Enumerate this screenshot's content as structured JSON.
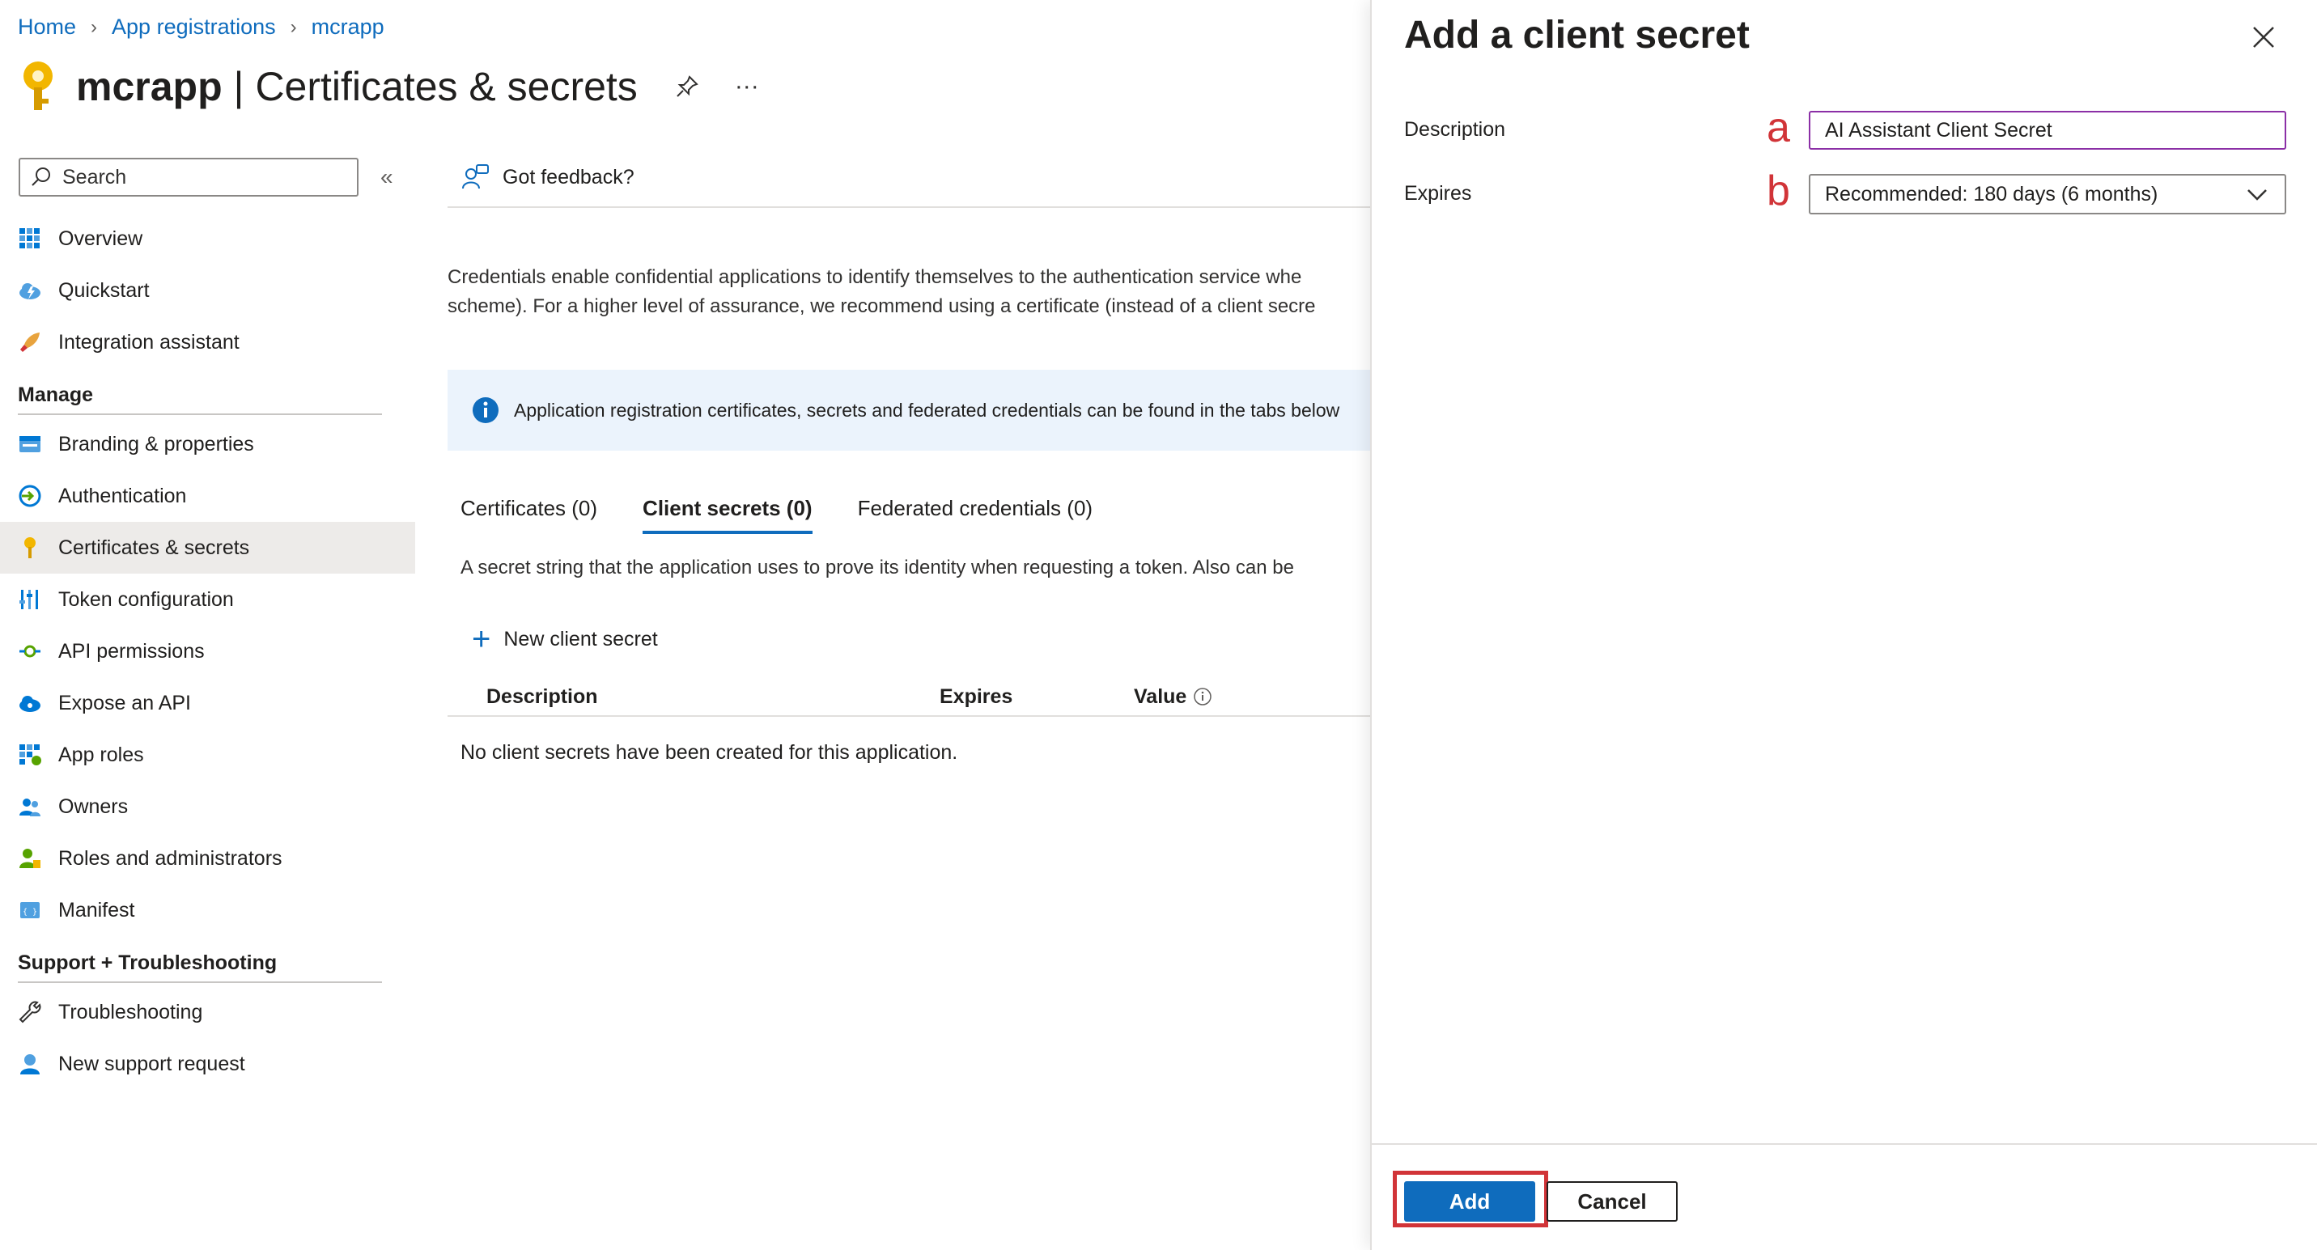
{
  "breadcrumb": {
    "home": "Home",
    "app_registrations": "App registrations",
    "app": "mcrapp"
  },
  "header": {
    "app_name": "mcrapp",
    "separator": "|",
    "page_name": "Certificates & secrets",
    "pin_icon": "pin-icon",
    "more": "···"
  },
  "sidebar": {
    "search_placeholder": "Search",
    "collapse": "«",
    "items_top": [
      {
        "label": "Overview",
        "icon": "overview-grid-icon"
      },
      {
        "label": "Quickstart",
        "icon": "cloud-lightning-icon"
      },
      {
        "label": "Integration assistant",
        "icon": "rocket-icon"
      }
    ],
    "manage_heading": "Manage",
    "manage_items": [
      {
        "label": "Branding & properties",
        "icon": "branding-icon"
      },
      {
        "label": "Authentication",
        "icon": "authentication-icon"
      },
      {
        "label": "Certificates & secrets",
        "icon": "key-icon",
        "active": true
      },
      {
        "label": "Token configuration",
        "icon": "token-bars-icon"
      },
      {
        "label": "API permissions",
        "icon": "api-permissions-icon"
      },
      {
        "label": "Expose an API",
        "icon": "cloud-api-icon"
      },
      {
        "label": "App roles",
        "icon": "app-roles-grid-icon"
      },
      {
        "label": "Owners",
        "icon": "owners-icon"
      },
      {
        "label": "Roles and administrators",
        "icon": "roles-admin-icon"
      },
      {
        "label": "Manifest",
        "icon": "manifest-icon"
      }
    ],
    "support_heading": "Support + Troubleshooting",
    "support_items": [
      {
        "label": "Troubleshooting",
        "icon": "wrench-icon"
      },
      {
        "label": "New support request",
        "icon": "support-person-icon"
      }
    ]
  },
  "main": {
    "feedback": "Got feedback?",
    "description_line1": "Credentials enable confidential applications to identify themselves to the authentication service whe",
    "description_line2": "scheme). For a higher level of assurance, we recommend using a certificate (instead of a client secre",
    "info_text": "Application registration certificates, secrets and federated credentials can be found in the tabs below",
    "tabs": [
      {
        "label": "Certificates (0)"
      },
      {
        "label": "Client secrets (0)",
        "active": true
      },
      {
        "label": "Federated credentials (0)"
      }
    ],
    "secret_description": "A secret string that the application uses to prove its identity when requesting a token. Also can be",
    "new_secret": "New client secret",
    "columns": {
      "description": "Description",
      "expires": "Expires",
      "value": "Value"
    },
    "empty_message": "No client secrets have been created for this application."
  },
  "panel": {
    "title": "Add a client secret",
    "description_label": "Description",
    "description_marker": "a",
    "description_value": "AI Assistant Client Secret",
    "expires_label": "Expires",
    "expires_marker": "b",
    "expires_value": "Recommended: 180 days (6 months)",
    "add_button": "Add",
    "cancel_button": "Cancel",
    "highlight_color": "#d13438"
  },
  "colors": {
    "accent": "#0f6cbd",
    "info_background": "#ebf3fc",
    "annotation_red": "#d13438",
    "focus_border": "#8b2fa6"
  }
}
